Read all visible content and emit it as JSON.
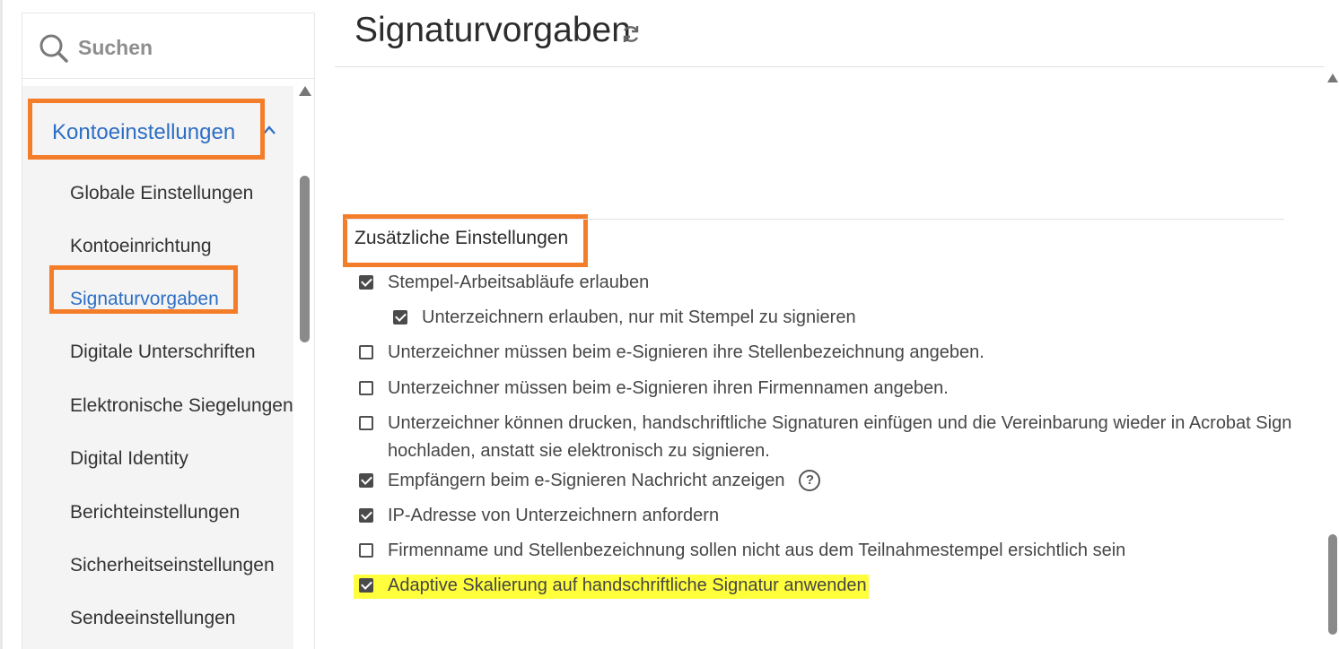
{
  "search": {
    "placeholder": "Suchen"
  },
  "sidebar": {
    "section_label": "Kontoeinstellungen",
    "items": [
      {
        "label": "Globale Einstellungen",
        "active": false
      },
      {
        "label": "Kontoeinrichtung",
        "active": false
      },
      {
        "label": "Signaturvorgaben",
        "active": true
      },
      {
        "label": "Digitale Unterschriften",
        "active": false
      },
      {
        "label": "Elektronische Siegelungen",
        "active": false
      },
      {
        "label": "Digital Identity",
        "active": false
      },
      {
        "label": "Berichteinstellungen",
        "active": false
      },
      {
        "label": "Sicherheitseinstellungen",
        "active": false
      },
      {
        "label": "Sendeeinstellungen",
        "active": false
      }
    ]
  },
  "main": {
    "title": "Signaturvorgaben",
    "section_heading": "Zusätzliche Einstellungen",
    "options": [
      {
        "label": "Stempel-Arbeitsabläufe erlauben",
        "checked": true
      },
      {
        "label": "Unterzeichnern erlauben, nur mit Stempel zu signieren",
        "checked": true
      },
      {
        "label": "Unterzeichner müssen beim e-Signieren ihre Stellenbezeichnung angeben.",
        "checked": false
      },
      {
        "label": "Unterzeichner müssen beim e-Signieren ihren Firmennamen angeben.",
        "checked": false
      },
      {
        "label": "Unterzeichner können drucken, handschriftliche Signaturen einfügen und die Vereinbarung wieder in Acrobat Sign hochladen, anstatt sie elektronisch zu signieren.",
        "checked": false
      },
      {
        "label": "Empfängern beim e-Signieren Nachricht anzeigen",
        "checked": true
      },
      {
        "label": "IP-Adresse von Unterzeichnern anfordern",
        "checked": true
      },
      {
        "label": "Firmenname und Stellenbezeichnung sollen nicht aus dem Teilnahmestempel ersichtlich sein",
        "checked": false
      },
      {
        "label": "Adaptive Skalierung auf handschriftliche Signatur anwenden",
        "checked": true
      }
    ],
    "help_glyph": "?"
  },
  "colors": {
    "accent_blue": "#2c6ec5",
    "callout_orange": "#f47d2a",
    "highlight_yellow": "#ffff3b"
  }
}
